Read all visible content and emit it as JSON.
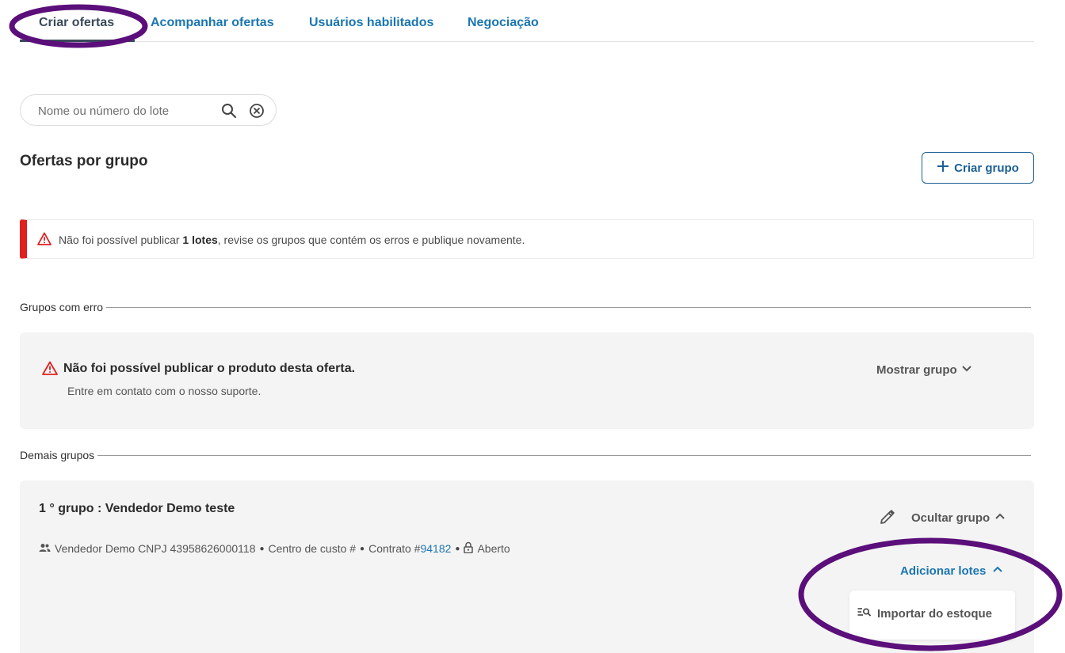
{
  "tabs": [
    {
      "label": "Criar ofertas",
      "active": true
    },
    {
      "label": "Acompanhar ofertas",
      "active": false
    },
    {
      "label": "Usuários habilitados",
      "active": false
    },
    {
      "label": "Negociação",
      "active": false
    }
  ],
  "search": {
    "placeholder": "Nome ou número do lote",
    "value": "",
    "search_icon": "search-icon",
    "clear_icon": "clear-circle-icon"
  },
  "heading": {
    "title": "Ofertas por grupo",
    "create_group_label": "Criar grupo"
  },
  "alert": {
    "prefix": "Não foi possível publicar ",
    "bold": "1 lotes",
    "suffix": ", revise os grupos que contém os erros e publique novamente.",
    "color": "#e01f1f"
  },
  "sections": {
    "errors_label": "Grupos com erro",
    "others_label": "Demais grupos"
  },
  "error_group": {
    "title": "Não foi possível publicar o produto desta oferta.",
    "subtitle": "Entre em contato com o nosso suporte.",
    "show_label": "Mostrar grupo"
  },
  "group": {
    "title": "1 ° grupo : Vendedor Demo teste",
    "seller": "Vendedor Demo CNPJ 43958626000118",
    "cost_center": "Centro de custo #",
    "contract_prefix": "Contrato #",
    "contract_number": "94182",
    "status": "Aberto",
    "hide_label": "Ocultar grupo",
    "add_lots_label": "Adicionar lotes",
    "menu_items": [
      {
        "label": "Importar do estoque",
        "icon": "import-search-icon"
      }
    ]
  },
  "colors": {
    "accent": "#1b76b0",
    "annotation": "#5b0f7a"
  }
}
